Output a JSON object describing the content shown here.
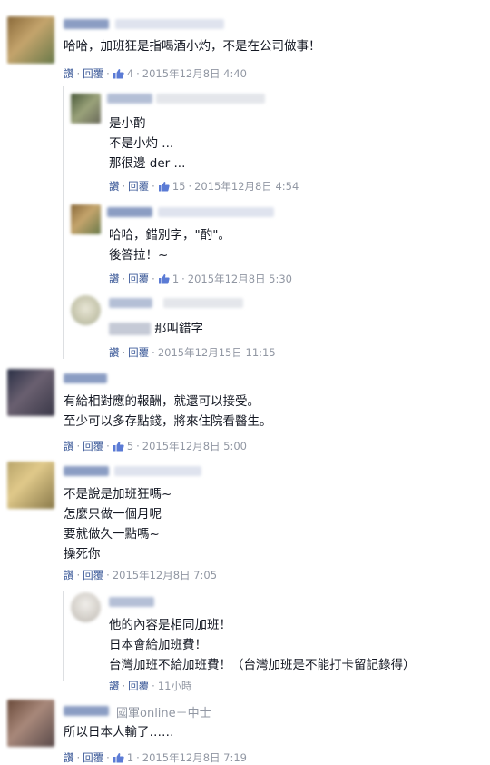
{
  "actions": {
    "like": "讚",
    "reply": "回覆",
    "dot": "·"
  },
  "comments": [
    {
      "text": "哈哈，加班狂是指喝酒小灼，不是在公司做事！",
      "likes": "4",
      "time": "2015年12月8日 4:40"
    },
    {
      "text": "是小酌\n不是小灼 ...\n那很邊 der ...",
      "likes": "15",
      "time": "2015年12月8日 4:54"
    },
    {
      "text": "哈哈，錯別字，\"酌\"。\n後答拉！~",
      "likes": "1",
      "time": "2015年12月8日 5:30"
    },
    {
      "text": "那叫錯字",
      "time": "2015年12月15日 11:15"
    },
    {
      "text": "有給相對應的報酬，就還可以接受。\n至少可以多存點錢，將來住院看醫生。",
      "likes": "5",
      "time": "2015年12月8日 5:00"
    },
    {
      "text": "不是說是加班狂嗎~\n怎麼只做一個月呢\n要就做久一點嗎~\n操死你",
      "time": "2015年12月8日 7:05"
    },
    {
      "text": "他的內容是相同加班！\n日本會給加班費！\n台灣加班不給加班費！（台灣加班是不能打卡留記錄得）",
      "time": "11小時"
    },
    {
      "tag": "國軍online－中士",
      "text": "所以日本人輸了……",
      "likes": "1",
      "time": "2015年12月8日 7:19"
    }
  ]
}
